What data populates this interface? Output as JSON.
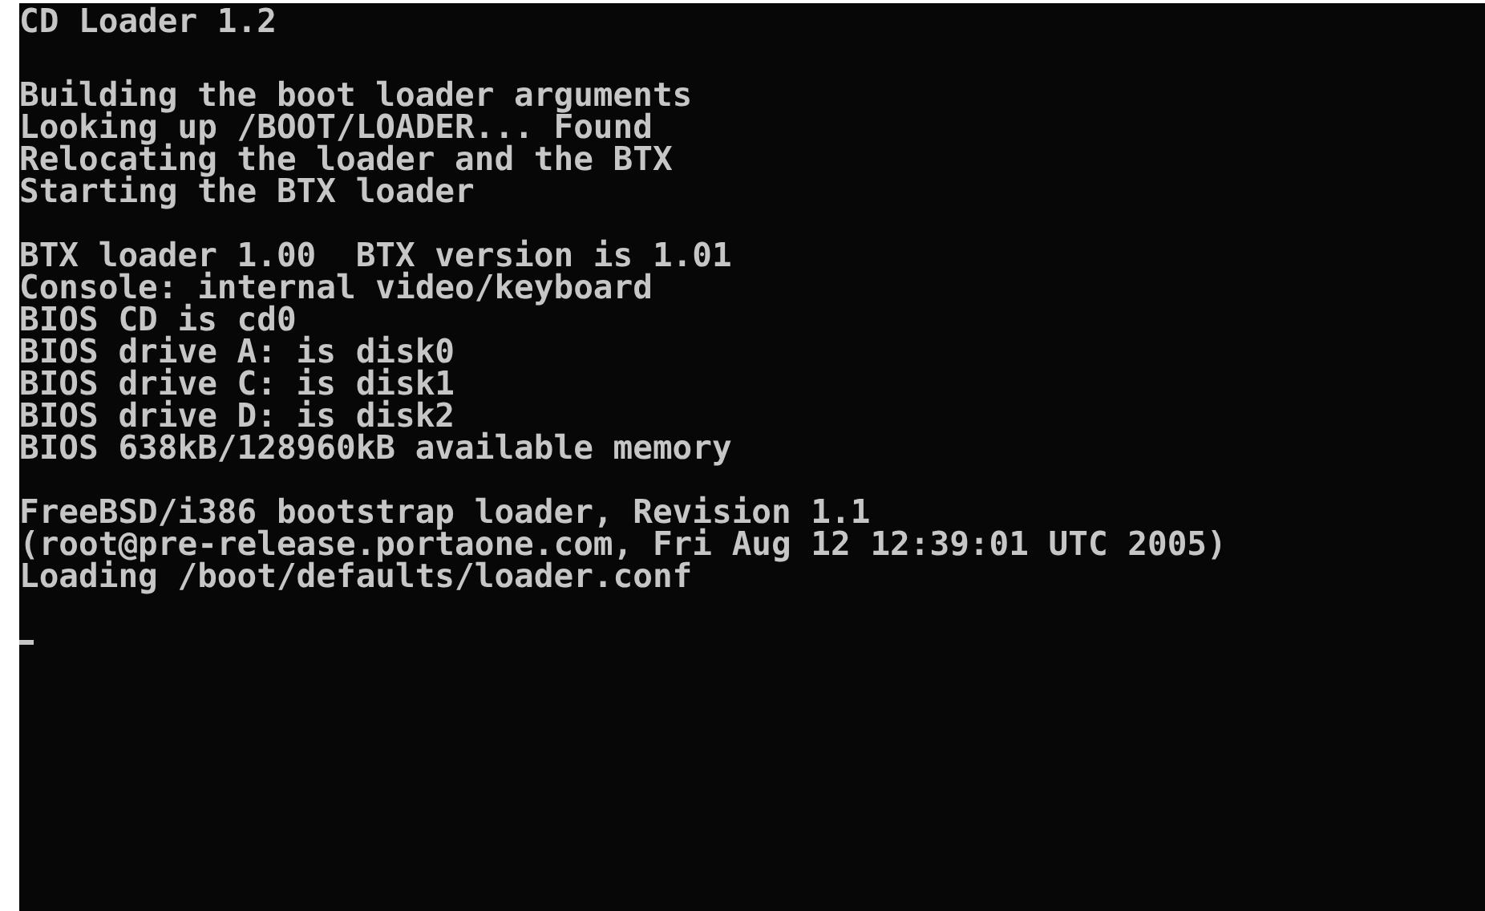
{
  "console": {
    "blocks": [
      {
        "lines": [
          "CD Loader 1.2"
        ]
      },
      {
        "lines": [
          "Building the boot loader arguments",
          "Looking up /BOOT/LOADER... Found",
          "Relocating the loader and the BTX",
          "Starting the BTX loader"
        ]
      },
      {
        "lines": [
          "BTX loader 1.00  BTX version is 1.01",
          "Console: internal video/keyboard",
          "BIOS CD is cd0",
          "BIOS drive A: is disk0",
          "BIOS drive C: is disk1",
          "BIOS drive D: is disk2",
          "BIOS 638kB/128960kB available memory"
        ]
      },
      {
        "lines": [
          "FreeBSD/i386 bootstrap loader, Revision 1.1",
          "(root@pre-release.portaone.com, Fri Aug 12 12:39:01 UTC 2005)",
          "Loading /boot/defaults/loader.conf"
        ]
      }
    ]
  }
}
